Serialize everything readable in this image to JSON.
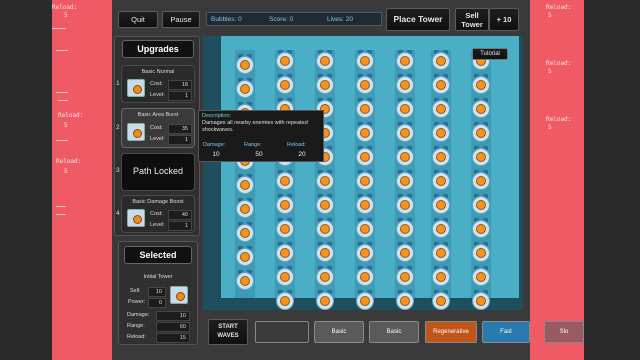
{
  "background_text": {
    "left": [
      "Reload:",
      "5",
      "Reload:",
      "5",
      "Reload:",
      "5"
    ],
    "right": [
      "Reload:",
      "5",
      "Reload:",
      "5",
      "Reload:",
      "5"
    ]
  },
  "top": {
    "quit": "Quit",
    "pause": "Pause",
    "bubbles": "Bubbles: 0",
    "score": "Score: 0",
    "lives": "Lives: 20",
    "place_tower": "Place Tower",
    "sell_tower": "Sell Tower",
    "sell_value": "+ 10"
  },
  "upgrades": {
    "title": "Upgrades",
    "cost_label": "Cost:",
    "level_label": "Level:",
    "items": [
      {
        "num": "1",
        "name": "Basic Normal",
        "cost": "18",
        "level": "1"
      },
      {
        "num": "2",
        "name": "Basic Area Burst",
        "cost": "35",
        "level": "1"
      },
      {
        "num": "3",
        "name": "Path Locked"
      },
      {
        "num": "4",
        "name": "Basic Damage Boost",
        "cost": "40",
        "level": "1"
      }
    ]
  },
  "selected": {
    "title": "Selected",
    "name": "Initial Tower",
    "sell_label": "Sell:",
    "sell": "10",
    "power_label": "Power:",
    "power": "0",
    "damage_label": "Damage:",
    "damage": "10",
    "range_label": "Range:",
    "range": "60",
    "reload_label": "Reload:",
    "reload": "15"
  },
  "tooltip": {
    "desc_label": "Description:",
    "desc": "Damages all nearby enemies with repeated shockwaves.",
    "damage_label": "Damage:",
    "damage": "10",
    "range_label": "Range:",
    "range": "50",
    "reload_label": "Reload:",
    "reload": "20"
  },
  "board": {
    "tutorial": "Tutorial"
  },
  "bottom": {
    "start_waves": "START WAVES",
    "basic1": "Basic",
    "basic2": "Basic",
    "regenerative": "Regenerative",
    "fast": "Fast",
    "slow": "Slo"
  },
  "colors": {
    "background": "#f05a64",
    "path": "#4aaec6",
    "tower_core": "#f4941e",
    "regenerative": "#c0561a",
    "fast": "#2a7ab0"
  }
}
